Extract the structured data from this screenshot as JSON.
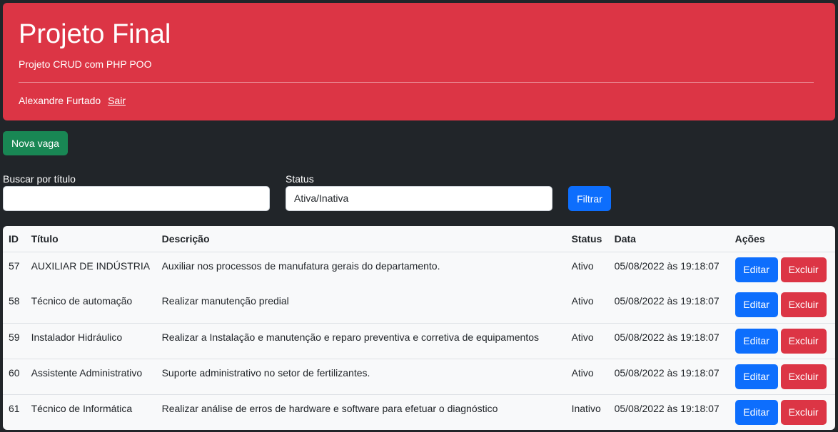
{
  "header": {
    "title": "Projeto Final",
    "subtitle": "Projeto CRUD com PHP POO",
    "user_name": "Alexandre Furtado",
    "logout_label": "Sair"
  },
  "toolbar": {
    "new_label": "Nova vaga"
  },
  "filters": {
    "search_label": "Buscar por título",
    "search_value": "",
    "status_label": "Status",
    "status_value": "Ativa/Inativa",
    "filter_button": "Filtrar"
  },
  "table": {
    "columns": [
      "ID",
      "Título",
      "Descrição",
      "Status",
      "Data",
      "Ações"
    ],
    "edit_label": "Editar",
    "delete_label": "Excluir",
    "rows": [
      {
        "id": "57",
        "titulo": "AUXILIAR DE INDÚSTRIA",
        "descricao": "Auxiliar nos processos de manufatura gerais do departamento.",
        "status": "Ativo",
        "data": "05/08/2022 às 19:18:07"
      },
      {
        "id": "58",
        "titulo": "Técnico de automação",
        "descricao": "Realizar manutenção predial",
        "status": "Ativo",
        "data": "05/08/2022 às 19:18:07"
      },
      {
        "id": "59",
        "titulo": "Instalador Hidráulico",
        "descricao": "Realizar a Instalação e manutenção e reparo preventiva e corretiva de equipamentos",
        "status": "Ativo",
        "data": "05/08/2022 às 19:18:07"
      },
      {
        "id": "60",
        "titulo": "Assistente Administrativo",
        "descricao": "Suporte administrativo no setor de fertilizantes.",
        "status": "Ativo",
        "data": "05/08/2022 às 19:18:07"
      },
      {
        "id": "61",
        "titulo": "Técnico de Informática",
        "descricao": "Realizar análise de erros de hardware e software para efetuar o diagnóstico",
        "status": "Inativo",
        "data": "05/08/2022 às 19:18:07"
      }
    ]
  }
}
